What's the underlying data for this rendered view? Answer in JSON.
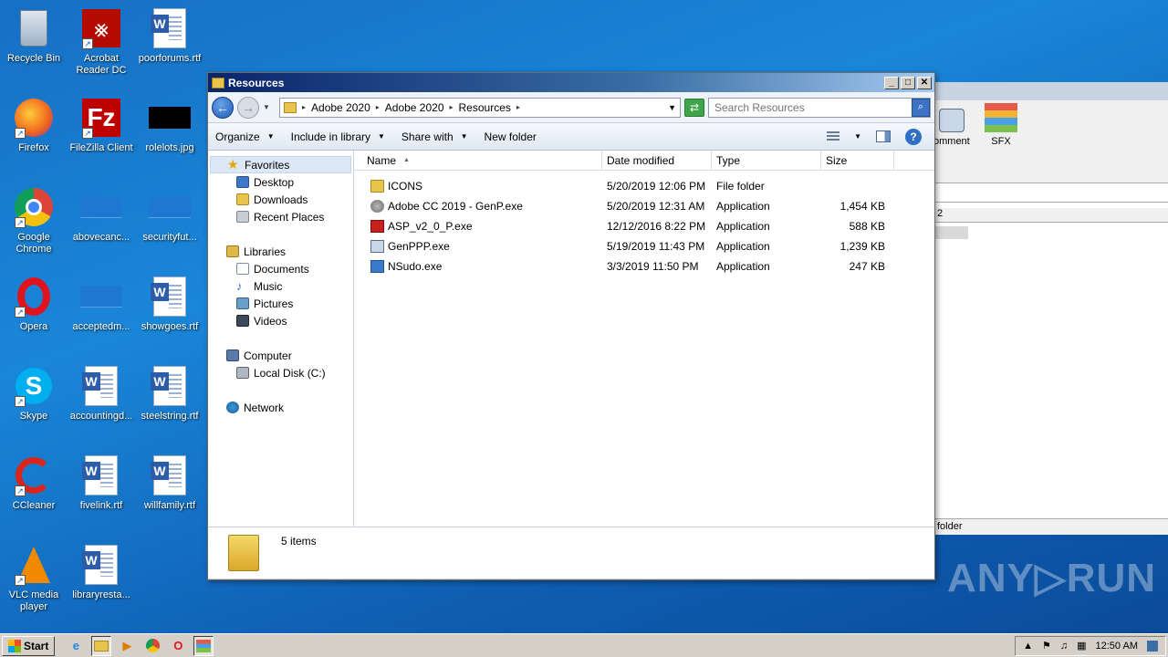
{
  "desktop": {
    "icons": [
      {
        "label": "Recycle Bin"
      },
      {
        "label": "Acrobat Reader DC"
      },
      {
        "label": "poorforums.rtf"
      },
      {
        "label": "Firefox"
      },
      {
        "label": "FileZilla Client"
      },
      {
        "label": "rolelots.jpg"
      },
      {
        "label": "Google Chrome"
      },
      {
        "label": "abovecanc..."
      },
      {
        "label": "securityfut..."
      },
      {
        "label": "Opera"
      },
      {
        "label": "acceptedm..."
      },
      {
        "label": "showgoes.rtf"
      },
      {
        "label": "Skype"
      },
      {
        "label": "accountingd..."
      },
      {
        "label": "steelstring.rtf"
      },
      {
        "label": "CCleaner"
      },
      {
        "label": "fivelink.rtf"
      },
      {
        "label": "willfamily.rtf"
      },
      {
        "label": "VLC media player"
      },
      {
        "label": "libraryresta..."
      }
    ]
  },
  "bg_window": {
    "tool_comment": "omment",
    "tool_sfx": "SFX",
    "col_fragment": "2",
    "status_fragment": "folder"
  },
  "window": {
    "title": "Resources",
    "breadcrumb": [
      "Adobe 2020",
      "Adobe 2020",
      "Resources"
    ],
    "search_placeholder": "Search Resources",
    "commands": {
      "organize": "Organize",
      "include_in_library": "Include in library",
      "share_with": "Share with",
      "new_folder": "New folder"
    },
    "nav": {
      "favorites": "Favorites",
      "desktop": "Desktop",
      "downloads": "Downloads",
      "recent_places": "Recent Places",
      "libraries": "Libraries",
      "documents": "Documents",
      "music": "Music",
      "pictures": "Pictures",
      "videos": "Videos",
      "computer": "Computer",
      "local_disk": "Local Disk (C:)",
      "network": "Network"
    },
    "columns": {
      "name": "Name",
      "date_modified": "Date modified",
      "type": "Type",
      "size": "Size"
    },
    "files": [
      {
        "name": "ICONS",
        "date": "5/20/2019 12:06 PM",
        "type": "File folder",
        "size": ""
      },
      {
        "name": "Adobe CC 2019 - GenP.exe",
        "date": "5/20/2019 12:31 AM",
        "type": "Application",
        "size": "1,454 KB"
      },
      {
        "name": "ASP_v2_0_P.exe",
        "date": "12/12/2016 8:22 PM",
        "type": "Application",
        "size": "588 KB"
      },
      {
        "name": "GenPPP.exe",
        "date": "5/19/2019 11:43 PM",
        "type": "Application",
        "size": "1,239 KB"
      },
      {
        "name": "NSudo.exe",
        "date": "3/3/2019 11:50 PM",
        "type": "Application",
        "size": "247 KB"
      }
    ],
    "details": {
      "count": "5 items"
    }
  },
  "watermark": "ANY▷RUN",
  "taskbar": {
    "start": "Start",
    "clock": "12:50 AM"
  }
}
